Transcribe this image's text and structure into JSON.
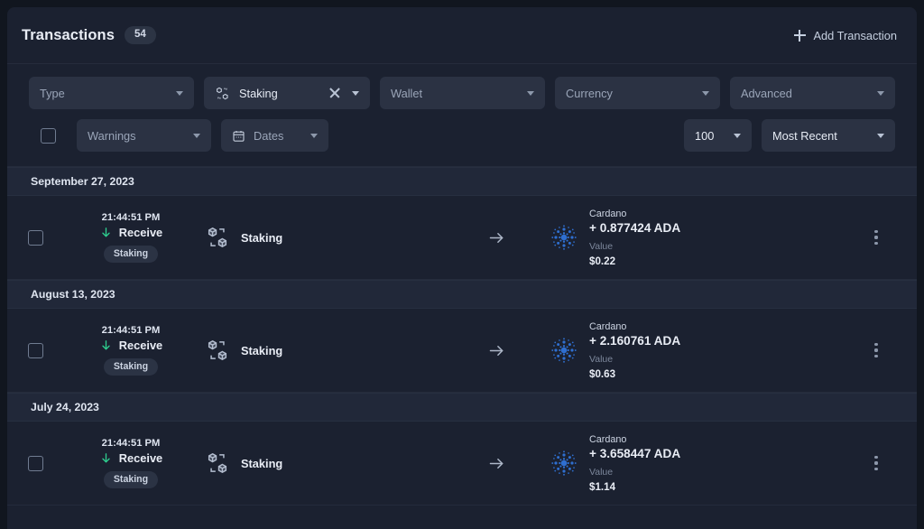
{
  "header": {
    "title": "Transactions",
    "count": "54",
    "add_button": "Add Transaction",
    "plus_icon": "plus-icon"
  },
  "filters": {
    "row1": [
      {
        "name": "type",
        "label": "Type",
        "active": false,
        "icon": null,
        "clearable": false
      },
      {
        "name": "category",
        "label": "Staking",
        "active": true,
        "icon": "staking-icon",
        "clearable": true
      },
      {
        "name": "wallet",
        "label": "Wallet",
        "active": false,
        "icon": null,
        "clearable": false
      },
      {
        "name": "currency",
        "label": "Currency",
        "active": false,
        "icon": null,
        "clearable": false
      },
      {
        "name": "advanced",
        "label": "Advanced",
        "active": false,
        "icon": null,
        "clearable": false
      }
    ],
    "select_all": {
      "name": "select-all-checkbox",
      "checked": false
    },
    "row2": [
      {
        "name": "warnings",
        "label": "Warnings",
        "active": false,
        "icon": null
      },
      {
        "name": "dates",
        "label": "Dates",
        "active": false,
        "icon": "calendar-icon"
      }
    ],
    "page_size": {
      "name": "page-size",
      "label": "100"
    },
    "sort": {
      "name": "sort-order",
      "label": "Most Recent"
    }
  },
  "groups": [
    {
      "date": "September 27, 2023",
      "rows": [
        {
          "checked": false,
          "time": "21:44:51 PM",
          "direction": "Receive",
          "direction_icon": "arrow-down-icon",
          "tag": "Staking",
          "category": "Staking",
          "category_icon": "staking-cubes-icon",
          "transfer_icon": "arrow-right-icon",
          "coin_icon": "cardano-icon",
          "coin": "Cardano",
          "amount": "+ 0.877424 ADA",
          "value_label": "Value",
          "value": "$0.22",
          "menu_icon": "kebab-menu-icon"
        }
      ]
    },
    {
      "date": "August 13, 2023",
      "rows": [
        {
          "checked": false,
          "time": "21:44:51 PM",
          "direction": "Receive",
          "direction_icon": "arrow-down-icon",
          "tag": "Staking",
          "category": "Staking",
          "category_icon": "staking-cubes-icon",
          "transfer_icon": "arrow-right-icon",
          "coin_icon": "cardano-icon",
          "coin": "Cardano",
          "amount": "+ 2.160761 ADA",
          "value_label": "Value",
          "value": "$0.63",
          "menu_icon": "kebab-menu-icon"
        }
      ]
    },
    {
      "date": "July 24, 2023",
      "rows": [
        {
          "checked": false,
          "time": "21:44:51 PM",
          "direction": "Receive",
          "direction_icon": "arrow-down-icon",
          "tag": "Staking",
          "category": "Staking",
          "category_icon": "staking-cubes-icon",
          "transfer_icon": "arrow-right-icon",
          "coin_icon": "cardano-icon",
          "coin": "Cardano",
          "amount": "+ 3.658447 ADA",
          "value_label": "Value",
          "value": "$1.14",
          "menu_icon": "kebab-menu-icon"
        }
      ]
    }
  ],
  "colors": {
    "page_bg": "#11161f",
    "panel_bg": "#1b2130",
    "control_bg": "#2b3243",
    "date_bg": "#212839",
    "receive_green": "#2ecf8f",
    "cardano_blue": "#2f6fd0",
    "text_primary": "#e9edf5",
    "text_muted": "#9aa5b8"
  }
}
